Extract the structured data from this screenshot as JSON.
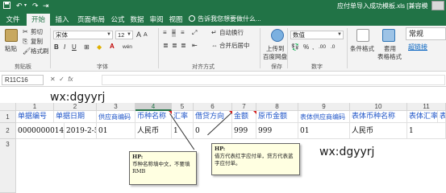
{
  "titlebar": {
    "doc_title": "应付单导入成功模板.xls [兼容模",
    "save_icon": "save-icon",
    "undo_icon": "undo-icon",
    "redo_icon": "redo-icon"
  },
  "tabs": [
    {
      "label": "文件"
    },
    {
      "label": "开始"
    },
    {
      "label": "插入"
    },
    {
      "label": "页面布局"
    },
    {
      "label": "公式"
    },
    {
      "label": "数据"
    },
    {
      "label": "审阅"
    },
    {
      "label": "视图"
    }
  ],
  "tell_me": "告诉我您想要做什么...",
  "ribbon": {
    "clipboard": {
      "paste": "粘贴",
      "cut": "剪切",
      "copy": "复制",
      "format_painter": "格式刷",
      "label": "剪贴板"
    },
    "font": {
      "name": "宋体",
      "size": "12",
      "label": "字体",
      "bold": "B",
      "italic": "I",
      "underline": "U",
      "wen": "wén"
    },
    "alignment": {
      "wrap": "自动换行",
      "merge": "合并后居中",
      "label": "对齐方式"
    },
    "number": {
      "format": "数值",
      "label": "数字"
    },
    "cloud": {
      "upload": "上传到",
      "baidu": "百度网盘",
      "label": "保存"
    },
    "styles": {
      "conditional": "条件格式",
      "table": "套用",
      "table2": "表格格式",
      "normal": "常规",
      "hyperlink": "超链接"
    }
  },
  "formula_bar": {
    "name_box": "R11C16"
  },
  "grid": {
    "columns": [
      "1",
      "2",
      "3",
      "4",
      "5",
      "6",
      "7",
      "8",
      "9",
      "10",
      "11"
    ],
    "rows": [
      "1",
      "2",
      "3"
    ],
    "row1": [
      "单据编号",
      "单据日期",
      "供应商编码",
      "币种名称",
      "汇率",
      "借贷方向",
      "金额",
      "原币金额",
      "表体供应商编码",
      "表体币种名称",
      "表体汇率",
      "表"
    ],
    "row2": [
      "0000000014",
      "2019-2-5",
      "01",
      "人民币",
      "1",
      "0",
      "999",
      "999",
      "01",
      "人民币",
      "1",
      ""
    ]
  },
  "comments": [
    {
      "title": "HP:",
      "text": "币种名称填中文，不要填RMB"
    },
    {
      "title": "HP:",
      "text": "借方代表红字应付单，贷方代表蓝字应付单。"
    }
  ],
  "watermark": "wx:dgyyrj",
  "colors": {
    "excel_green": "#217346",
    "header_blue": "#1f55c8",
    "comment_bg": "#ffffe1"
  }
}
